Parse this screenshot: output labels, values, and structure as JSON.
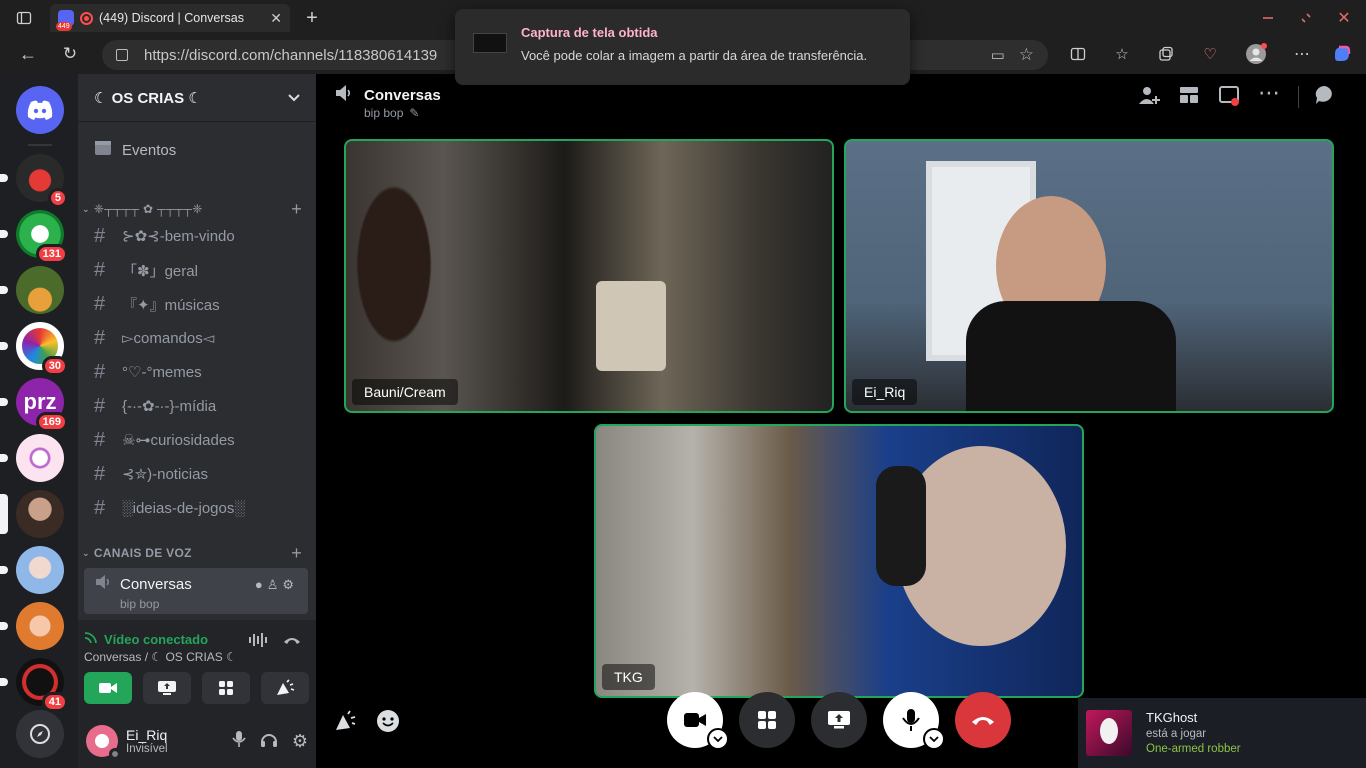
{
  "browser": {
    "tab_title": "(449) Discord | Conversas",
    "tab_badge": "449",
    "url": "https://discord.com/channels/118380614139"
  },
  "toast": {
    "title": "Captura de tela obtida",
    "message": "Você pode colar a imagem a partir da área de transferência."
  },
  "servers": [
    {
      "name": "server-1",
      "count": "5"
    },
    {
      "name": "server-2",
      "count": "131"
    },
    {
      "name": "server-3",
      "count": ""
    },
    {
      "name": "server-4",
      "count": "30"
    },
    {
      "name": "server-5",
      "count": "169"
    },
    {
      "name": "server-6",
      "count": ""
    },
    {
      "name": "server-7",
      "count": ""
    },
    {
      "name": "server-8",
      "count": ""
    },
    {
      "name": "server-9",
      "count": ""
    },
    {
      "name": "server-10",
      "count": "41"
    }
  ],
  "server_name": "☾ OS CRIAS ☾",
  "events_label": "Eventos",
  "category_text": "❈┬┬┬┬ ✿ ┬┬┬┬❈",
  "channels": [
    "⊱✿⊰-bem-vindo",
    "「✽」geral",
    "『✦』músicas",
    "▻comandos◅",
    "°♡-°memes",
    "{-·-✿-·-}-mídia",
    "☠⊶curiosidades",
    "⊰✮)-noticias",
    "░ideias-de-jogos░"
  ],
  "voice_category": "CANAIS DE VOZ",
  "voice_channel": {
    "name": "Conversas",
    "status": "bip bop"
  },
  "voice_connection": {
    "status": "Vídeo conectado",
    "location": "Conversas / ☾ OS CRIAS ☾"
  },
  "user": {
    "name": "Ei_Riq",
    "status": "Invisível"
  },
  "header": {
    "title": "Conversas",
    "subtitle": "bip bop"
  },
  "participants": [
    {
      "name": "Bauni/Cream"
    },
    {
      "name": "Ei_Riq"
    },
    {
      "name": "TKG"
    }
  ],
  "activity": {
    "user": "TKGhost",
    "verb": "está a jogar",
    "game": "One-armed robber"
  },
  "colors": {
    "speaking_border": "#23a55a",
    "hangup": "#da373c",
    "brand": "#5865f2",
    "mention": "#f23f43"
  }
}
